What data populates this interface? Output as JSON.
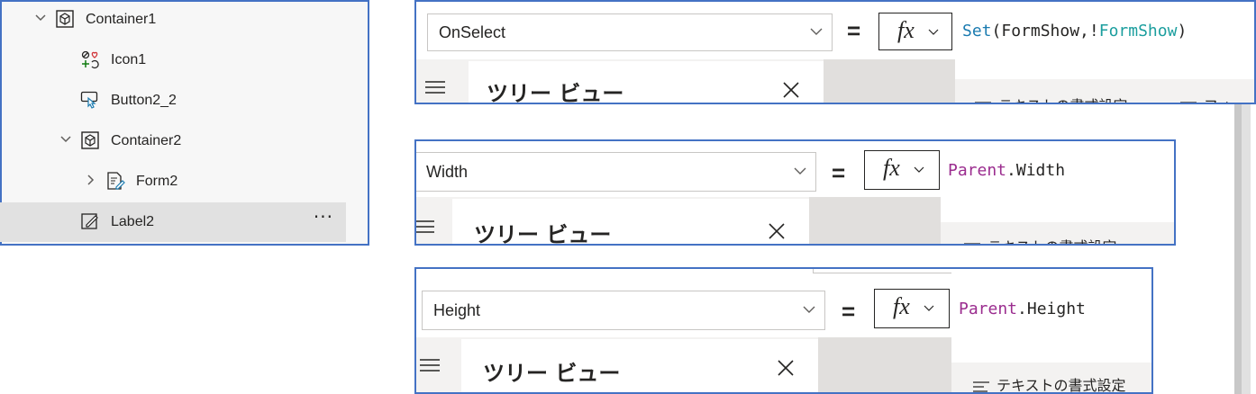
{
  "tree": {
    "items": [
      {
        "label": "Container1",
        "icon": "container-icon",
        "chevron": "chevron-down"
      },
      {
        "label": "Icon1",
        "icon": "icon-control-icon",
        "chevron": ""
      },
      {
        "label": "Button2_2",
        "icon": "button-icon",
        "chevron": ""
      },
      {
        "label": "Container2",
        "icon": "container-icon",
        "chevron": "chevron-down"
      },
      {
        "label": "Form2",
        "icon": "form-icon",
        "chevron": "chevron-right"
      },
      {
        "label": "Label2",
        "icon": "label-icon",
        "chevron": "",
        "selected": true
      }
    ],
    "more_label": "···"
  },
  "bars": [
    {
      "property": "OnSelect",
      "equals": "=",
      "fx": "fx",
      "formula": {
        "fn": "Set",
        "open": "(FormShow,!",
        "ctrl": "FormShow",
        "close": ")"
      },
      "tree_title": "ツリー ビュー",
      "format_label": "テキストの書式設定",
      "extra_label": "フォー"
    },
    {
      "property": "Width",
      "equals": "=",
      "fx": "fx",
      "formula": {
        "kw": "Parent",
        "rest": ".Width"
      },
      "tree_title": "ツリー ビュー",
      "format_label": "テキストの書式設定"
    },
    {
      "property": "Height",
      "equals": "=",
      "fx": "fx",
      "formula": {
        "kw": "Parent",
        "rest": ".Height"
      },
      "tree_title": "ツリー ビュー",
      "format_label": "テキストの書式設定"
    }
  ],
  "colors": {
    "accent_border": "#4472c4",
    "function": "#1b7bb0",
    "keyword": "#9b2d8f",
    "control": "#1b9e9e"
  }
}
